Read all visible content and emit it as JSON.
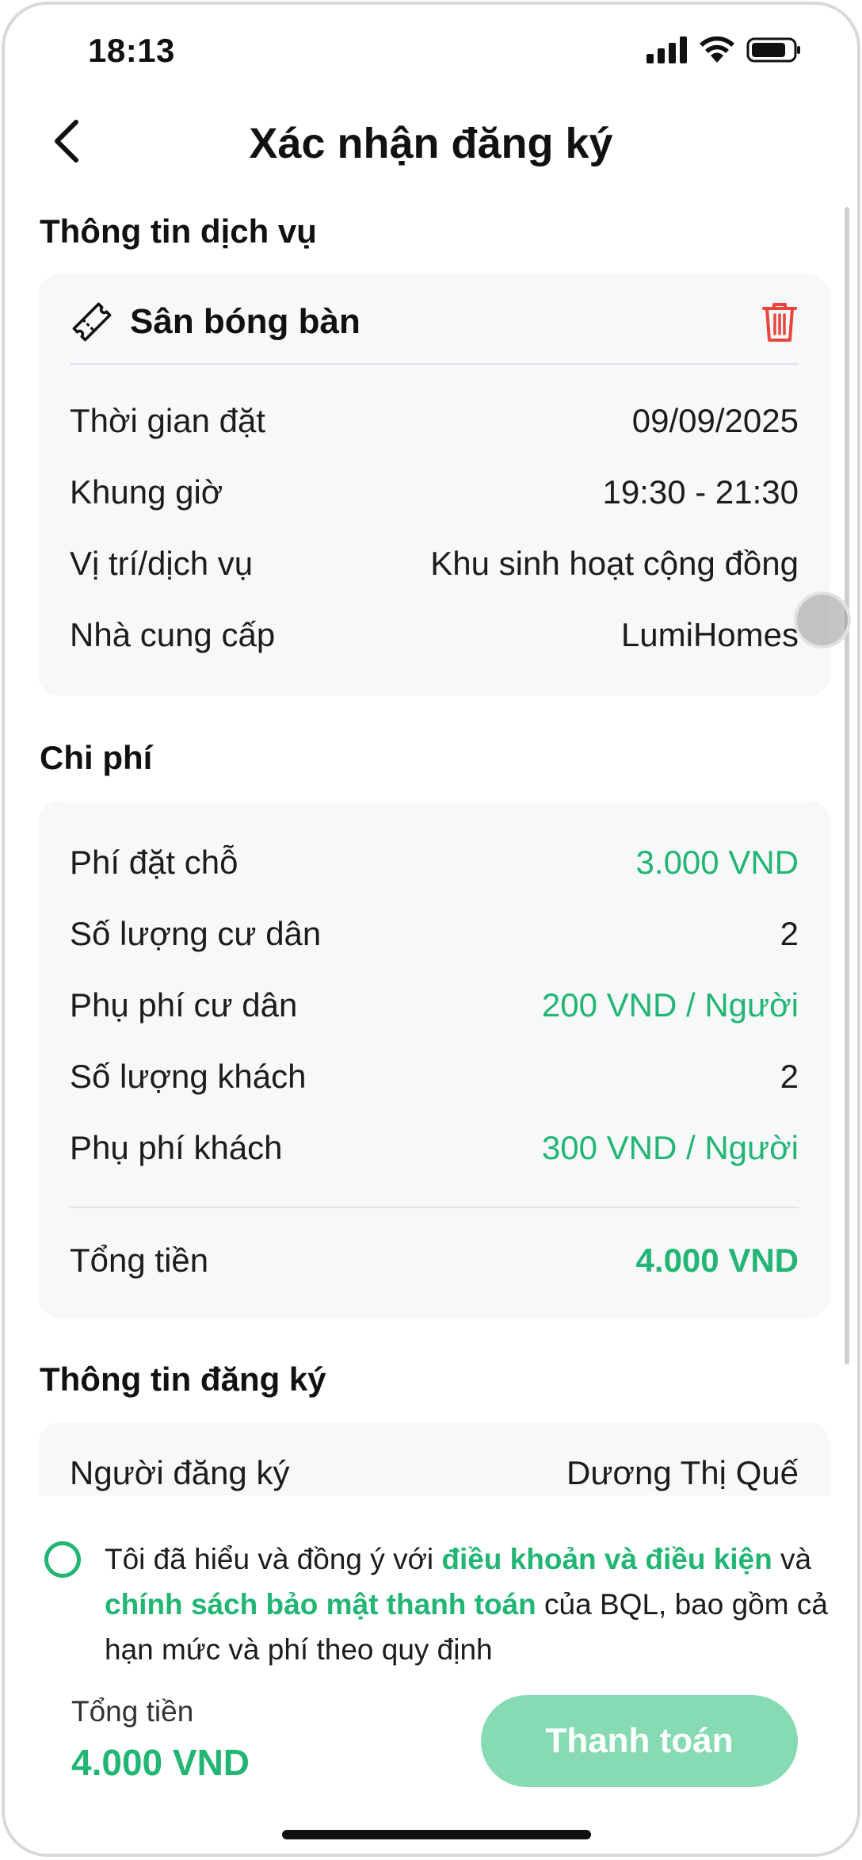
{
  "status_bar": {
    "time": "18:13"
  },
  "header": {
    "title": "Xác nhận đăng ký"
  },
  "service_section": {
    "title": "Thông tin dịch vụ",
    "service_name": "Sân bóng bàn",
    "rows": [
      {
        "label": "Thời gian đặt",
        "value": "09/09/2025"
      },
      {
        "label": "Khung giờ",
        "value": "19:30 - 21:30"
      },
      {
        "label": "Vị trí/dịch vụ",
        "value": "Khu sinh hoạt cộng đồng"
      },
      {
        "label": "Nhà cung cấp",
        "value": "LumiHomes"
      }
    ]
  },
  "cost_section": {
    "title": "Chi phí",
    "rows": [
      {
        "label": "Phí đặt chỗ",
        "value": "3.000 VND"
      },
      {
        "label": "Số lượng cư dân",
        "value": "2"
      },
      {
        "label": "Phụ phí cư dân",
        "value": "200 VND / Người"
      },
      {
        "label": "Số lượng khách",
        "value": "2"
      },
      {
        "label": "Phụ phí khách",
        "value": "300 VND / Người"
      }
    ],
    "total_label": "Tổng tiền",
    "total_value": "4.000 VND"
  },
  "registration_section": {
    "title": "Thông tin đăng ký",
    "rows": [
      {
        "label": "Người đăng ký",
        "value": "Dương Thị Quế"
      }
    ]
  },
  "agreement": {
    "text_1": "Tôi đã hiểu và đồng ý với ",
    "link_1": "điều khoản và điều kiện",
    "text_2": " và ",
    "link_2": "chính sách bảo mật thanh toán",
    "text_3": " của BQL, bao gồm cả hạn mức và phí theo quy định"
  },
  "footer": {
    "total_label": "Tổng tiền",
    "total_value": "4.000 VND",
    "pay_button": "Thanh toán"
  },
  "colors": {
    "accent": "#22b573",
    "button_disabled": "#86dbb3",
    "card_bg": "#f7f8fa",
    "delete_icon": "#e8453c"
  }
}
